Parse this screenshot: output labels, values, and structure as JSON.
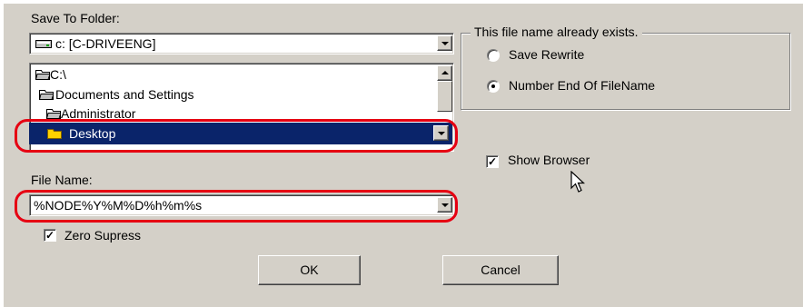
{
  "save_to_folder": {
    "label": "Save To Folder:",
    "drive_value": "c: [C-DRIVEENG]",
    "tree_items": [
      {
        "label": "C:\\",
        "icon": "open-folder-icon"
      },
      {
        "label": "Documents and Settings",
        "icon": "open-folder-icon"
      },
      {
        "label": "Administrator",
        "icon": "open-folder-icon"
      },
      {
        "label": "Desktop",
        "icon": "folder-icon",
        "selected": true
      }
    ]
  },
  "file_name": {
    "label": "File Name:",
    "value": "%NODE%Y%M%D%h%m%s"
  },
  "zero_supress": {
    "label": "Zero Supress",
    "checked": true
  },
  "exists_group": {
    "title": "This file name already exists.",
    "options": [
      {
        "label": "Save Rewrite",
        "selected": false
      },
      {
        "label": "Number End Of FileName",
        "selected": true
      }
    ]
  },
  "show_browser": {
    "label": "Show Browser",
    "checked": true
  },
  "buttons": {
    "ok": "OK",
    "cancel": "Cancel"
  },
  "colors": {
    "highlight": "#e60012",
    "selection": "#0a246a",
    "dialog_bg": "#d4d0c8"
  }
}
